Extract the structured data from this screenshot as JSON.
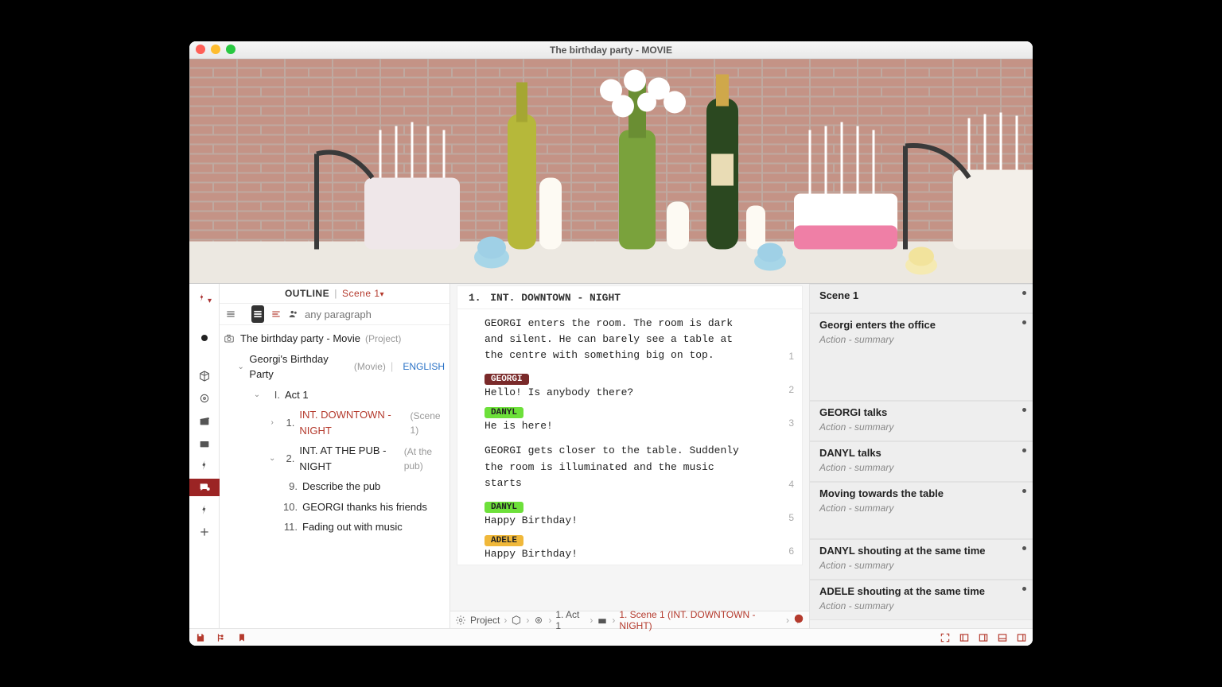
{
  "window": {
    "title": "The birthday party - MOVIE"
  },
  "outline": {
    "header_label": "OUTLINE",
    "scene_selector": "Scene 1",
    "search_placeholder": "any paragraph",
    "root_title": "The birthday party - Movie",
    "root_type": "(Project)",
    "sub_title": "Georgi's Birthday Party",
    "sub_type": "(Movie)",
    "language": "ENGLISH",
    "act": {
      "num": "I.",
      "label": "Act 1"
    },
    "scene1": {
      "num": "1.",
      "label": "INT.  DOWNTOWN - NIGHT",
      "paren": "(Scene 1)"
    },
    "scene2": {
      "num": "2.",
      "label": "INT.  AT THE PUB - NIGHT",
      "paren": "(At the pub)"
    },
    "beats": {
      "b9": {
        "num": "9.",
        "label": "Describe the pub"
      },
      "b10": {
        "num": "10.",
        "label": "GEORGI thanks his friends"
      },
      "b11": {
        "num": "11.",
        "label": "Fading out with music"
      }
    }
  },
  "script": {
    "slug_num": "1.",
    "slug_text": "INT. DOWNTOWN - NIGHT",
    "p1": "GEORGI enters the room. The room is dark and silent. He can barely see a table at the centre with something big on top.",
    "p1_num": "1",
    "c1": "GEORGI",
    "d1": "Hello! Is anybody there?",
    "d1_num": "2",
    "c2": "DANYL",
    "d2": "He is here!",
    "d2_num": "3",
    "p2": "GEORGI gets closer to the table. Suddenly the room is illuminated and the music starts",
    "p2_num": "4",
    "c3": "DANYL",
    "d3": "Happy Birthday!",
    "d3_num": "5",
    "c4": "ADELE",
    "d4": "Happy Birthday!",
    "d4_num": "6"
  },
  "breadcrumb": {
    "project": "Project",
    "act": "1. Act 1",
    "scene": "1. Scene 1 (INT.  DOWNTOWN - NIGHT)"
  },
  "notes": {
    "n1": {
      "title": "Scene 1"
    },
    "n2": {
      "title": "Georgi enters the office",
      "sub": "Action - summary"
    },
    "n3": {
      "title": "GEORGI talks",
      "sub": "Action - summary"
    },
    "n4": {
      "title": "DANYL talks",
      "sub": "Action - summary"
    },
    "n5": {
      "title": "Moving towards the table",
      "sub": "Action - summary"
    },
    "n6": {
      "title": "DANYL shouting at the same time",
      "sub": "Action - summary"
    },
    "n7": {
      "title": "ADELE shouting at the same time",
      "sub": "Action - summary"
    }
  }
}
